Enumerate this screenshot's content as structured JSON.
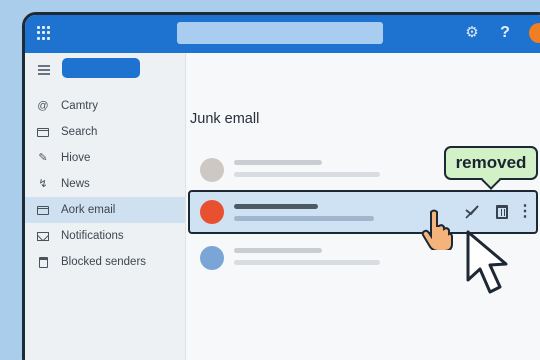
{
  "folder": {
    "title": "Junk emall"
  },
  "sidebar": {
    "items": [
      {
        "label": "Camtry",
        "icon": "at-sign-icon"
      },
      {
        "label": "Search",
        "icon": "inbox-icon"
      },
      {
        "label": "Hiove",
        "icon": "pencil-icon"
      },
      {
        "label": "News",
        "icon": "broom-icon"
      },
      {
        "label": "Aork email",
        "icon": "mailbox-icon",
        "active": true
      },
      {
        "label": "Notifications",
        "icon": "envelope-icon"
      },
      {
        "label": "Blocked senders",
        "icon": "trash-icon"
      }
    ]
  },
  "callout": {
    "text": "removed"
  },
  "colors": {
    "brand": "#1d73cf",
    "avatar_orange": "#ef7f22",
    "selected_row": "#cfe2f4",
    "callout_bg": "#d2f1c6",
    "sender_gray": "#cdc8c3",
    "sender_red": "#e8502f",
    "sender_blue": "#7aa5d6"
  }
}
